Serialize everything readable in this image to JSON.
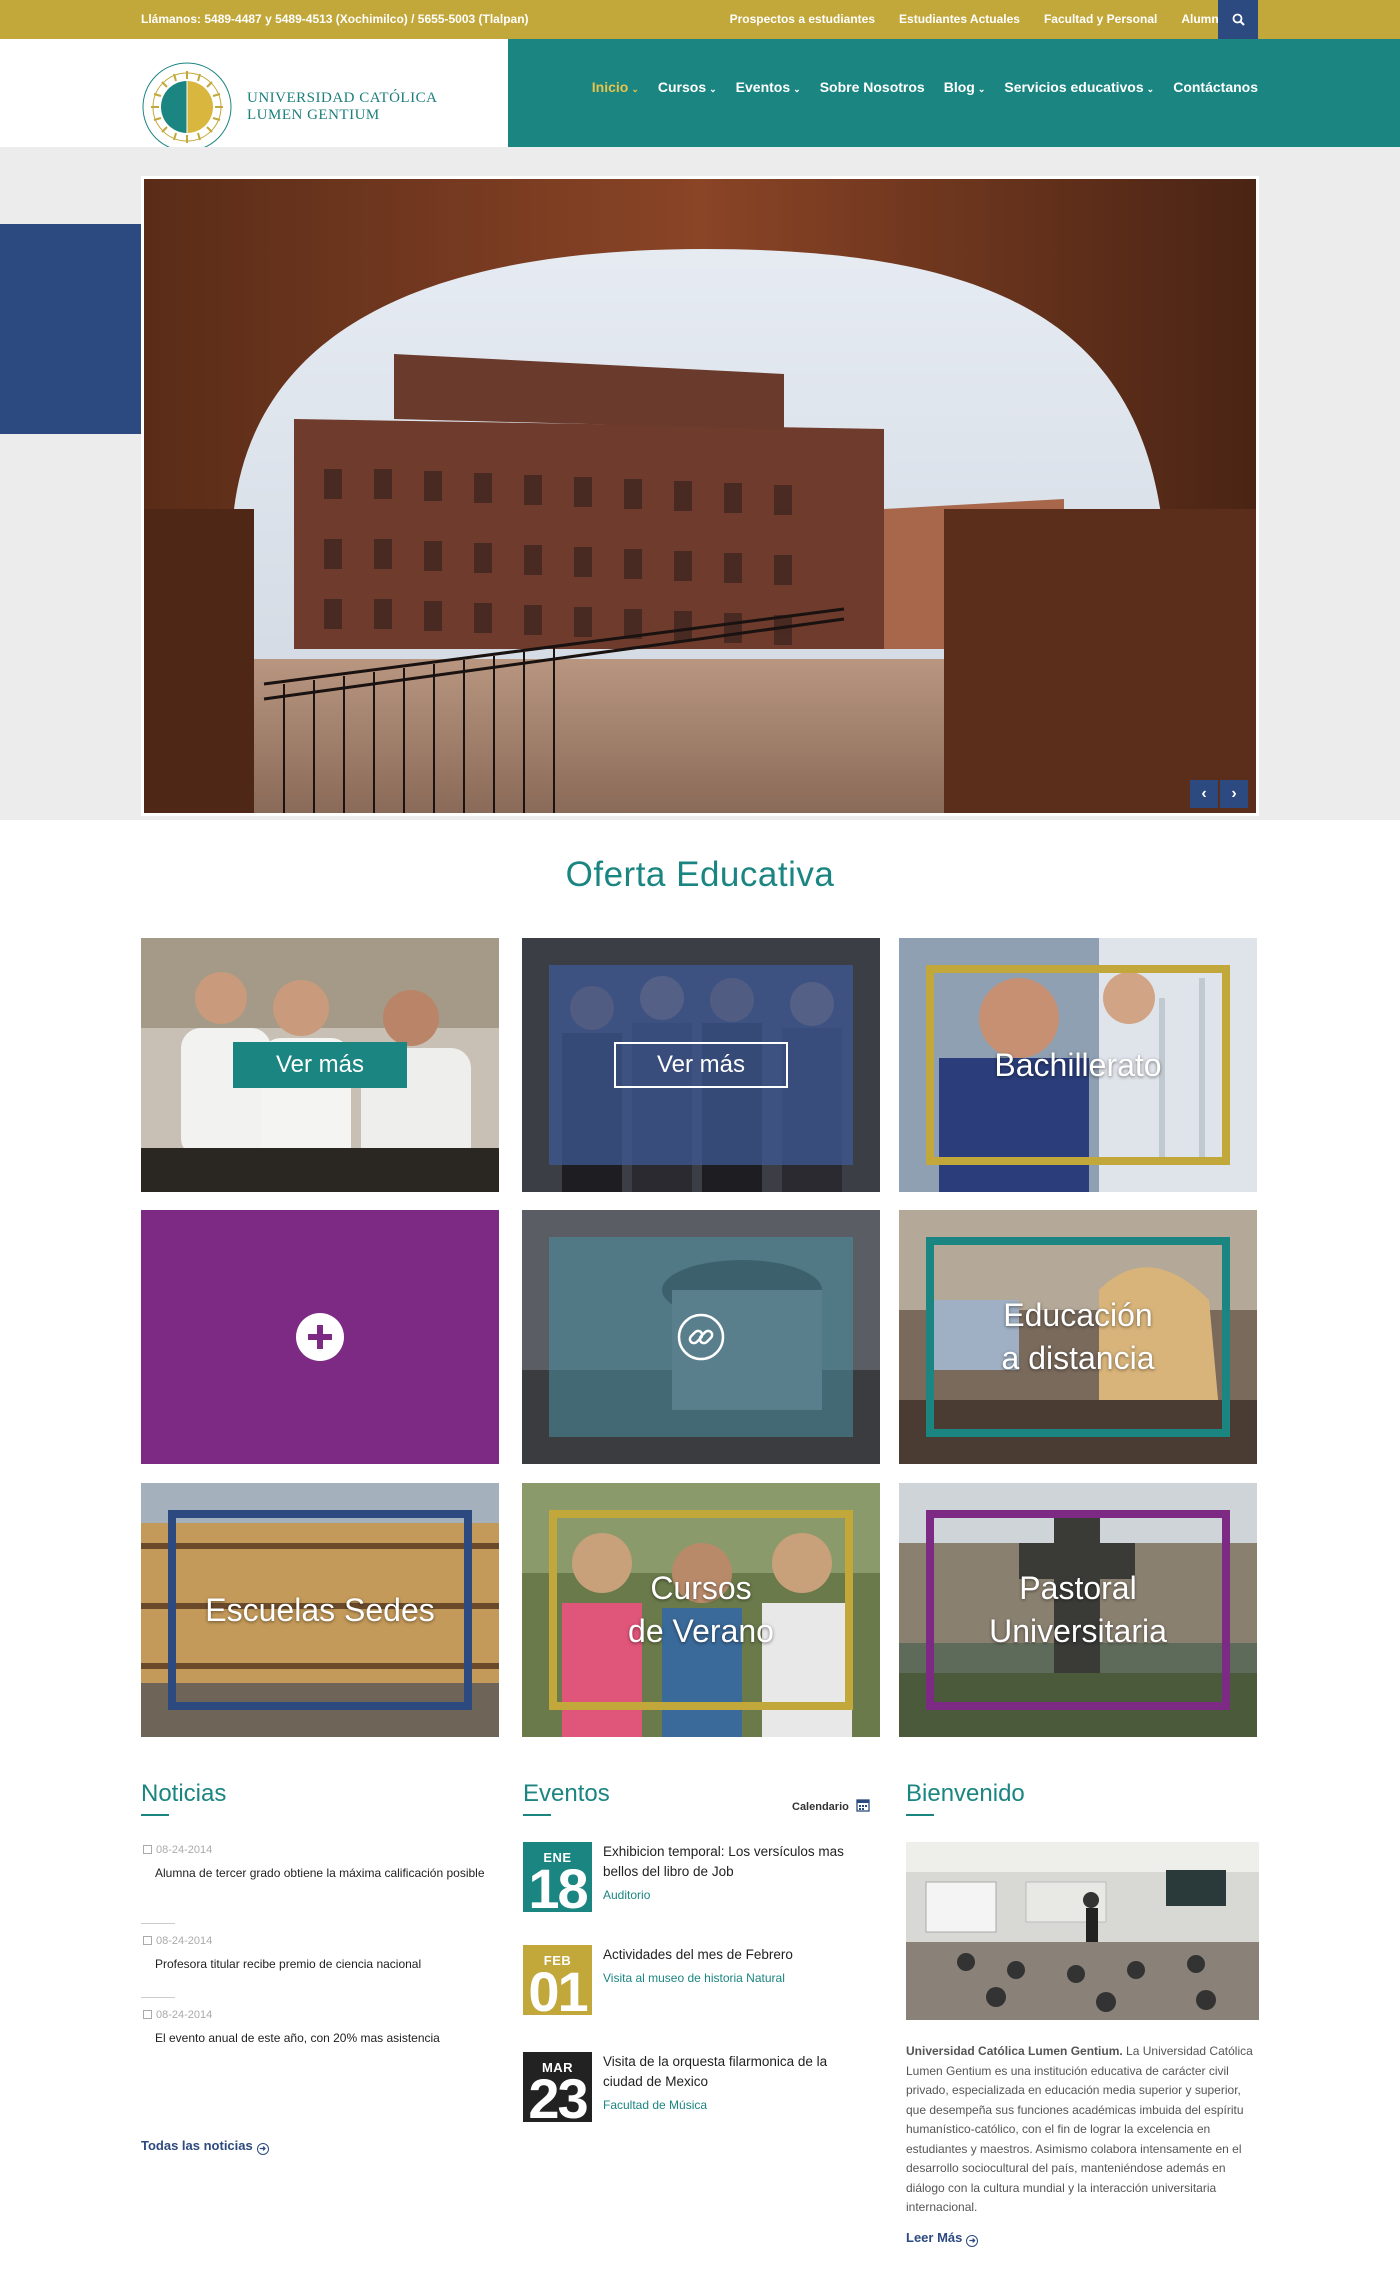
{
  "topbar": {
    "phone": "Llámanos: 5489-4487 y 5489-4513 (Xochimilco) / 5655-5003 (Tlalpan)",
    "links": [
      "Prospectos a estudiantes",
      "Estudiantes Actuales",
      "Facultad y Personal",
      "Alumnado"
    ]
  },
  "logo": {
    "line1": "UNIVERSIDAD CATÓLICA",
    "line2": "LUMEN GENTIUM"
  },
  "nav": {
    "items": [
      "Inicio",
      "Cursos",
      "Eventos",
      "Sobre Nosotros",
      "Blog",
      "Servicios educativos",
      "Contáctanos"
    ]
  },
  "section_title": "Oferta Educativa",
  "tiles": {
    "btn1": "Ver más",
    "btn2": "Ver más",
    "bachillerato": "Bachillerato",
    "educacion1": "Educación",
    "educacion2": "a distancia",
    "escuelas": "Escuelas Sedes",
    "cursos1": "Cursos",
    "cursos2": "de Verano",
    "pastoral1": "Pastoral",
    "pastoral2": "Universitaria"
  },
  "news": {
    "title": "Noticias",
    "items": [
      {
        "date": "08-24-2014",
        "text": "Alumna de tercer grado obtiene la máxima calificación posible"
      },
      {
        "date": "08-24-2014",
        "text": "Profesora titular recibe premio de ciencia nacional"
      },
      {
        "date": "08-24-2014",
        "text": "El evento anual de este año, con 20% mas asistencia"
      }
    ],
    "all_link": "Todas las noticias"
  },
  "events": {
    "title": "Eventos",
    "calendar_link": "Calendario",
    "items": [
      {
        "month": "ENE",
        "day": "18",
        "title": "Exhibicion temporal: Los versículos mas bellos del libro de Job",
        "place": "Auditorio",
        "color": "#1b8581"
      },
      {
        "month": "FEB",
        "day": "01",
        "title": "Actividades del mes de Febrero",
        "place": "Visita al museo de historia Natural",
        "color": "#c2a83a"
      },
      {
        "month": "MAR",
        "day": "23",
        "title": "Visita de la orquesta filarmonica de la ciudad de Mexico",
        "place": "Facultad de Música",
        "color": "#222222"
      }
    ]
  },
  "welcome": {
    "title": "Bienvenido",
    "lead": "Universidad Católica Lumen Gentium.",
    "body": " La Universidad Católica Lumen Gentium es una institución educativa de carácter civil privado, especializada en educación media superior y superior, que desempeña sus funciones académicas imbuida del espíritu humanístico-católico, con el fin de lograr la excelencia en estudiantes y maestros. Asimismo colabora intensamente en el desarrollo sociocultural del país, manteniéndose además en diálogo con la cultura mundial y la interacción universitaria internacional.",
    "more_link": "Leer Más"
  },
  "colors": {
    "teal": "#1b8581",
    "gold": "#c2a83a",
    "navy": "#2d4a80",
    "purple": "#7c2a83"
  }
}
